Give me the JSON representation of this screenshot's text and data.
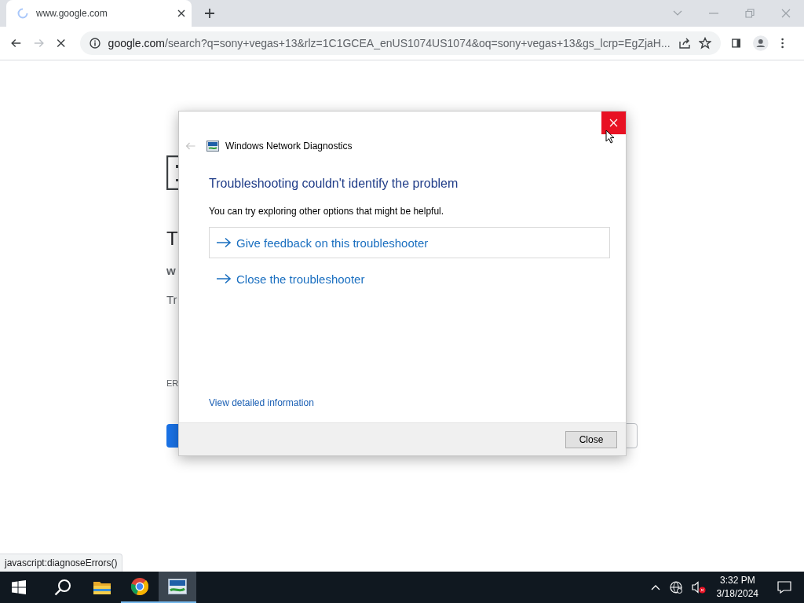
{
  "browser": {
    "tab": {
      "title": "www.google.com",
      "loading": true
    },
    "address": {
      "url": "google.com/search?q=sony+vegas+13&rlz=1C1GCEA_enUS1074US1074&oq=sony+vegas+13&gs_lcrp=EgZjaH..."
    },
    "page": {
      "heading": "T",
      "host": "w",
      "hint": "Tr",
      "code": "ER"
    },
    "status_url": "javascript:diagnoseErrors()"
  },
  "dialog": {
    "title": "Windows Network Diagnostics",
    "heading": "Troubleshooting couldn't identify the problem",
    "text": "You can try exploring other options that might be helpful.",
    "options": [
      {
        "label": "Give feedback on this troubleshooter",
        "focused": true
      },
      {
        "label": "Close the troubleshooter",
        "focused": false
      }
    ],
    "link": "View detailed information",
    "button": "Close"
  },
  "taskbar": {
    "apps": [
      {
        "kind": "explorer",
        "running": false,
        "active": false
      },
      {
        "kind": "chrome",
        "running": true,
        "active": false
      },
      {
        "kind": "diagnostics",
        "running": true,
        "active": true
      }
    ],
    "time": "3:32 PM",
    "date": "3/18/2024"
  }
}
